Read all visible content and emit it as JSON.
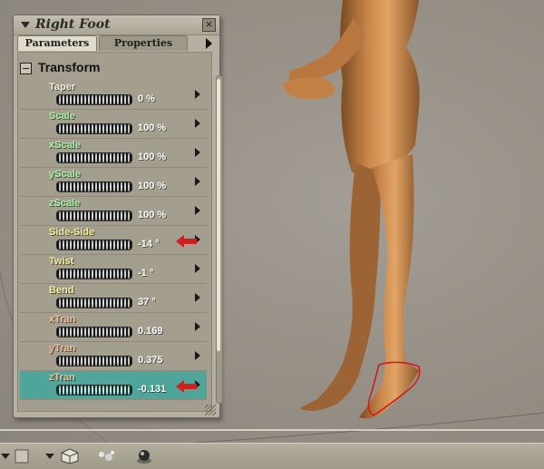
{
  "panel": {
    "title": "Right Foot",
    "close_label": "×",
    "tabs": [
      {
        "label": "Parameters",
        "active": true
      },
      {
        "label": "Properties",
        "active": false
      }
    ],
    "section": "Transform",
    "params": [
      {
        "label": "Taper",
        "value": "0 %",
        "color": "#f4f1e6",
        "selected": false,
        "marked": false
      },
      {
        "label": "Scale",
        "value": "100 %",
        "color": "#a9f2a6",
        "selected": false,
        "marked": false
      },
      {
        "label": "xScale",
        "value": "100 %",
        "color": "#a9f2a6",
        "selected": false,
        "marked": false
      },
      {
        "label": "yScale",
        "value": "100 %",
        "color": "#a9f2a6",
        "selected": false,
        "marked": false
      },
      {
        "label": "zScale",
        "value": "100 %",
        "color": "#a9f2a6",
        "selected": false,
        "marked": false
      },
      {
        "label": "Side-Side",
        "value": "-14 °",
        "color": "#f6ef9a",
        "selected": false,
        "marked": true
      },
      {
        "label": "Twist",
        "value": "-1 °",
        "color": "#f6ef9a",
        "selected": false,
        "marked": false
      },
      {
        "label": "Bend",
        "value": "37 °",
        "color": "#f6ef9a",
        "selected": false,
        "marked": false
      },
      {
        "label": "xTran",
        "value": "0.169",
        "color": "#f2c298",
        "selected": false,
        "marked": false
      },
      {
        "label": "yTran",
        "value": "0.375",
        "color": "#f2c298",
        "selected": false,
        "marked": false
      },
      {
        "label": "zTran",
        "value": "-0.131",
        "color": "#f2c298",
        "selected": true,
        "marked": true
      }
    ]
  },
  "icons": {
    "title_menu": "triangle-down-icon",
    "close": "close-icon",
    "tabs_menu": "triangle-right-icon",
    "collapse": "minus-box-icon",
    "row_menu": "triangle-right-icon",
    "marker": "red-arrow-icon"
  },
  "toolbar": {
    "items": [
      "dropdown-icon",
      "box-icon",
      "dropdown-icon",
      "cube-icon",
      "dots-icon",
      "sphere-icon"
    ]
  },
  "colors": {
    "panel_bg": "#b5b09f",
    "selected_row": "#4fa59a",
    "marker_red": "#cf1f1f",
    "figure_skin": "#c8864a",
    "viewport_bg": "#958f86"
  }
}
